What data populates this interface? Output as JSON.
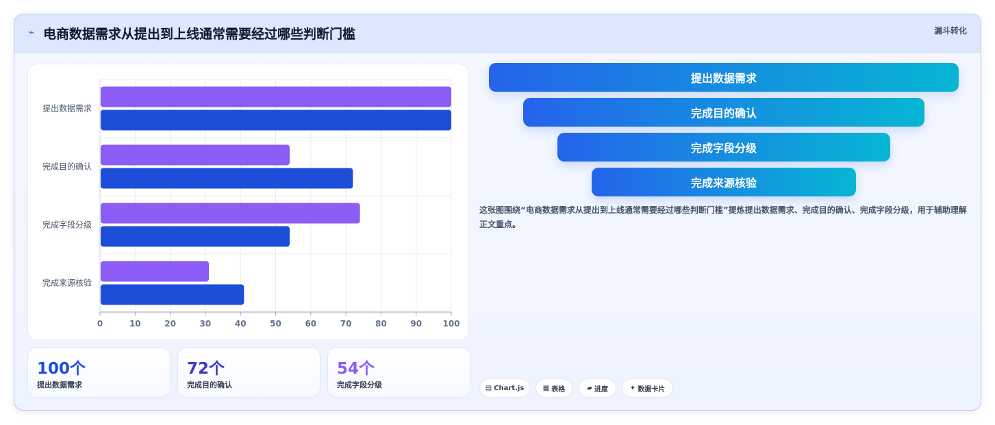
{
  "header": {
    "icon": "⌁",
    "title": "电商数据需求从提出到上线通常需要经过哪些判断门槛",
    "tag": "漏斗转化"
  },
  "chart_data": {
    "type": "bar",
    "orientation": "horizontal",
    "categories": [
      "提出数据需求",
      "完成目的确认",
      "完成字段分级",
      "完成来源核验"
    ],
    "series": [
      {
        "values": [
          100,
          54,
          74,
          31
        ],
        "color": "#8b5cf6"
      },
      {
        "values": [
          100,
          72,
          54,
          41
        ],
        "color": "#1d4ed8"
      }
    ],
    "xlim": [
      0,
      100
    ],
    "xticks": [
      0,
      10,
      20,
      30,
      40,
      50,
      60,
      70,
      80,
      90,
      100
    ],
    "grid": true
  },
  "kpis": [
    {
      "value": "100个",
      "label": "提出数据需求",
      "color": "#1d4ed8"
    },
    {
      "value": "72个",
      "label": "完成目的确认",
      "color": "#4338ca"
    },
    {
      "value": "54个",
      "label": "完成字段分级",
      "color": "#8b5cf6"
    }
  ],
  "funnel": [
    "提出数据需求",
    "完成目的确认",
    "完成字段分级",
    "完成来源核验"
  ],
  "description": "这张图围绕“电商数据需求从提出到上线通常需要经过哪些判断门槛”提炼提出数据需求、完成目的确认、完成字段分级，用于辅助理解正文重点。",
  "chips": [
    {
      "icon": "▤",
      "label": "Chart.js"
    },
    {
      "icon": "▦",
      "label": "表格"
    },
    {
      "icon": "▰",
      "label": "进度"
    },
    {
      "icon": "✦",
      "label": "数据卡片"
    }
  ]
}
